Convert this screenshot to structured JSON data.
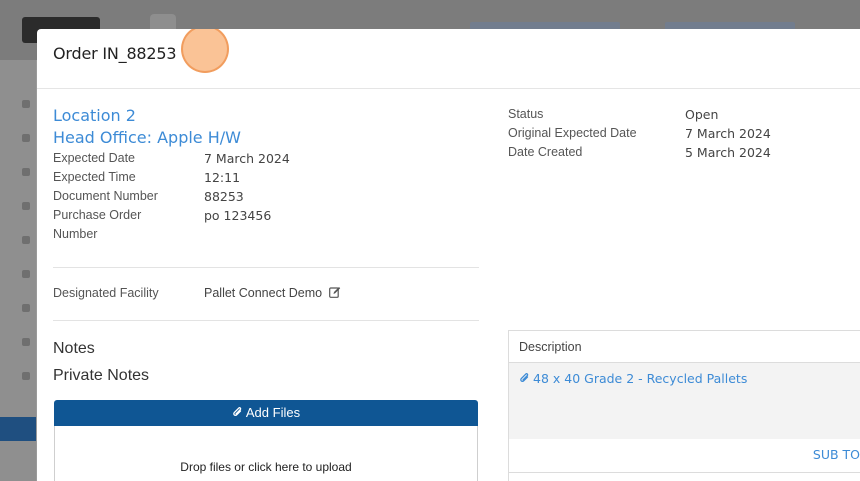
{
  "modal": {
    "title": "Order IN_88253"
  },
  "details": {
    "location": "Location 2",
    "head_office": "Head Office: Apple H/W",
    "fields": [
      {
        "label": "Expected Date",
        "value": "7 March 2024"
      },
      {
        "label": "Expected Time",
        "value": "12:11"
      },
      {
        "label": "Document Number",
        "value": "88253"
      },
      {
        "label": "Purchase Order",
        "value": "po 123456"
      }
    ],
    "po_label_cont": "Number",
    "facility_label": "Designated Facility",
    "facility_value": "Pallet Connect Demo"
  },
  "status": {
    "fields": [
      {
        "label": "Status",
        "value": "Open"
      },
      {
        "label": "Original Expected Date",
        "value": "7 March 2024"
      },
      {
        "label": "Date Created",
        "value": "5 March 2024"
      }
    ]
  },
  "notes": {
    "notes_label": "Notes",
    "private_label": "Private Notes"
  },
  "files": {
    "add_label": "Add Files",
    "drop_text": "Drop files or click here to upload"
  },
  "items_table": {
    "header": "Description",
    "row_item": "48 x 40 Grade 2 - Recycled Pallets",
    "subtotal_label": "SUB TO"
  },
  "colors": {
    "link": "#3d8bd6",
    "primary_button": "#0f5694",
    "click_marker": "#f9b278"
  },
  "icons": [
    "edit-icon",
    "paperclip-icon"
  ]
}
